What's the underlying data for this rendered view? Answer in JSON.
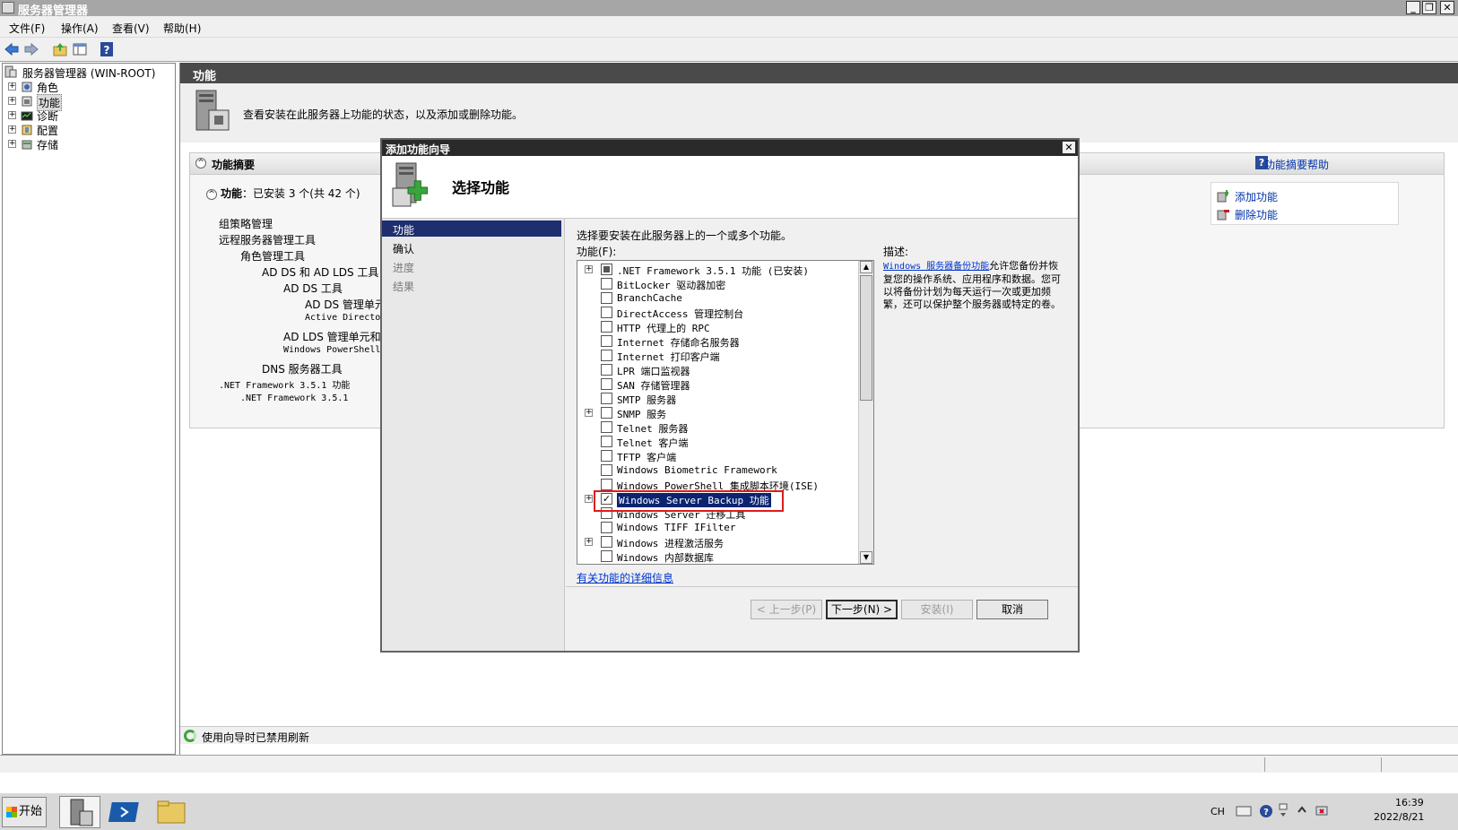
{
  "window": {
    "title": "服务器管理器"
  },
  "menu": [
    {
      "label": "文件(F)"
    },
    {
      "label": "操作(A)"
    },
    {
      "label": "查看(V)"
    },
    {
      "label": "帮助(H)"
    }
  ],
  "tree": {
    "root": "服务器管理器 (WIN-ROOT)",
    "items": [
      {
        "label": "角色"
      },
      {
        "label": "功能"
      },
      {
        "label": "诊断"
      },
      {
        "label": "配置"
      },
      {
        "label": "存储"
      }
    ]
  },
  "main": {
    "header": "功能",
    "intro": "查看安装在此服务器上功能的状态，以及添加或删除功能。",
    "summary": {
      "title": "功能摘要",
      "help_link": "功能摘要帮助",
      "features_label": "功能",
      "features_count": "：已安装 3 个(共 42 个)",
      "items": [
        {
          "label": "组策略管理",
          "level": 0
        },
        {
          "label": "远程服务器管理工具",
          "level": 0
        },
        {
          "label": "角色管理工具",
          "level": 1
        },
        {
          "label": "AD DS 和 AD LDS 工具",
          "level": 2
        },
        {
          "label": "AD DS 工具",
          "level": 3
        },
        {
          "label": "AD DS 管理单元",
          "level": 4
        },
        {
          "label": "Active Directo",
          "level": 4
        },
        {
          "label": "AD LDS 管理单元和命",
          "level": 3
        },
        {
          "label": "Windows PowerShell",
          "level": 3
        },
        {
          "label": "DNS 服务器工具",
          "level": 2
        },
        {
          "label": ".NET Framework 3.5.1 功能",
          "level": 0
        },
        {
          "label": ".NET Framework 3.5.1",
          "level": 1
        }
      ],
      "actions": [
        {
          "label": "添加功能"
        },
        {
          "label": "删除功能"
        }
      ]
    },
    "status": "使用向导时已禁用刷新"
  },
  "wizard": {
    "title": "添加功能向导",
    "heading": "选择功能",
    "nav": [
      {
        "label": "功能",
        "state": "active"
      },
      {
        "label": "确认",
        "state": "normal"
      },
      {
        "label": "进度",
        "state": "pending"
      },
      {
        "label": "结果",
        "state": "pending"
      }
    ],
    "instruction": "选择要安装在此服务器上的一个或多个功能。",
    "list_label": "功能(F):",
    "features": [
      {
        "label": ".NET Framework 3.5.1 功能  (已安装)",
        "expand": true,
        "check": "partial"
      },
      {
        "label": "BitLocker 驱动器加密",
        "expand": false,
        "check": "unchecked"
      },
      {
        "label": "BranchCache",
        "expand": false,
        "check": "unchecked"
      },
      {
        "label": "DirectAccess 管理控制台",
        "expand": false,
        "check": "unchecked"
      },
      {
        "label": "HTTP 代理上的 RPC",
        "expand": false,
        "check": "unchecked"
      },
      {
        "label": "Internet 存储命名服务器",
        "expand": false,
        "check": "unchecked"
      },
      {
        "label": "Internet 打印客户端",
        "expand": false,
        "check": "unchecked"
      },
      {
        "label": "LPR 端口监视器",
        "expand": false,
        "check": "unchecked"
      },
      {
        "label": "SAN 存储管理器",
        "expand": false,
        "check": "unchecked"
      },
      {
        "label": "SMTP 服务器",
        "expand": false,
        "check": "unchecked"
      },
      {
        "label": "SNMP 服务",
        "expand": true,
        "check": "unchecked"
      },
      {
        "label": "Telnet 服务器",
        "expand": false,
        "check": "unchecked"
      },
      {
        "label": "Telnet 客户端",
        "expand": false,
        "check": "unchecked"
      },
      {
        "label": "TFTP 客户端",
        "expand": false,
        "check": "unchecked"
      },
      {
        "label": "Windows Biometric Framework",
        "expand": false,
        "check": "unchecked"
      },
      {
        "label": "Windows PowerShell 集成脚本环境(ISE)",
        "expand": false,
        "check": "unchecked"
      },
      {
        "label": "Windows Server Backup 功能",
        "expand": true,
        "check": "checked",
        "selected": true
      },
      {
        "label": "Windows Server 迁移工具",
        "expand": false,
        "check": "unchecked"
      },
      {
        "label": "Windows TIFF IFilter",
        "expand": false,
        "check": "unchecked"
      },
      {
        "label": "Windows 进程激活服务",
        "expand": true,
        "check": "unchecked"
      },
      {
        "label": "Windows 内部数据库",
        "expand": false,
        "check": "unchecked"
      }
    ],
    "description_label": "描述:",
    "description_link": "Windows 服务器备份功能",
    "description_text": "允许您备份并恢复您的操作系统、应用程序和数据。您可以将备份计划为每天运行一次或更加频繁，还可以保护整个服务器或特定的卷。",
    "more_info": "有关功能的详细信息",
    "buttons": {
      "prev": "< 上一步(P)",
      "next": "下一步(N) >",
      "install": "安装(I)",
      "cancel": "取消"
    }
  },
  "taskbar": {
    "start": "开始",
    "lang": "CH",
    "time": "16:39",
    "date": "2022/8/21"
  },
  "colors": {
    "selection": "#0a2470",
    "nav_active": "#1e2e6e",
    "highlight": "#e01b1b",
    "link": "#0033aa"
  }
}
